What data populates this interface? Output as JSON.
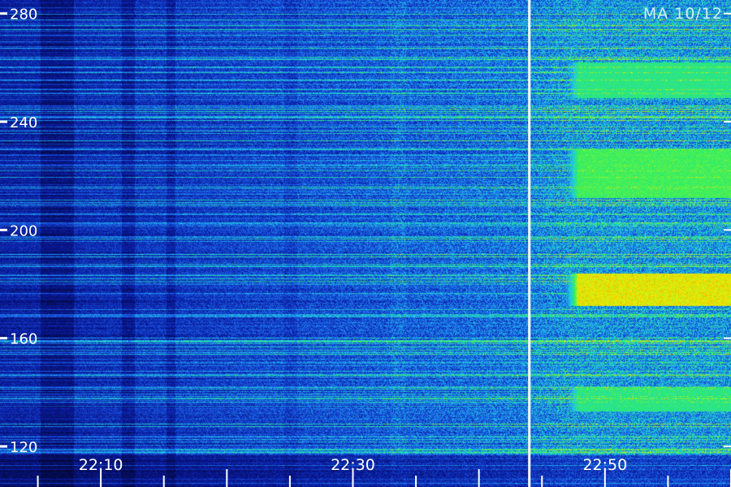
{
  "stamp": "MA 10/12",
  "chart_data": {
    "type": "heatmap",
    "title": "",
    "xlabel": "",
    "ylabel": "",
    "x_range": [
      "22:02",
      "23:00"
    ],
    "y_range": [
      108,
      285
    ],
    "x_tick_labels": [
      "22:10",
      "22:30",
      "22:50"
    ],
    "y_tick_labels": [
      120,
      160,
      200,
      240,
      280
    ],
    "colormap": [
      "#000010",
      "#0a1aa0",
      "#1a60e8",
      "#20c8e8",
      "#30f060",
      "#f0f000",
      "#ff2000"
    ],
    "marker_time": "22:44",
    "bright_bands": [
      {
        "from": 249,
        "to": 262,
        "level": "green"
      },
      {
        "from": 212,
        "to": 230,
        "level": "yellow-green"
      },
      {
        "from": 172,
        "to": 184,
        "level": "red-yellow"
      },
      {
        "from": 133,
        "to": 142,
        "level": "green"
      }
    ]
  },
  "colors": {
    "axis": "#ffffff",
    "marker": "#ffffff"
  }
}
